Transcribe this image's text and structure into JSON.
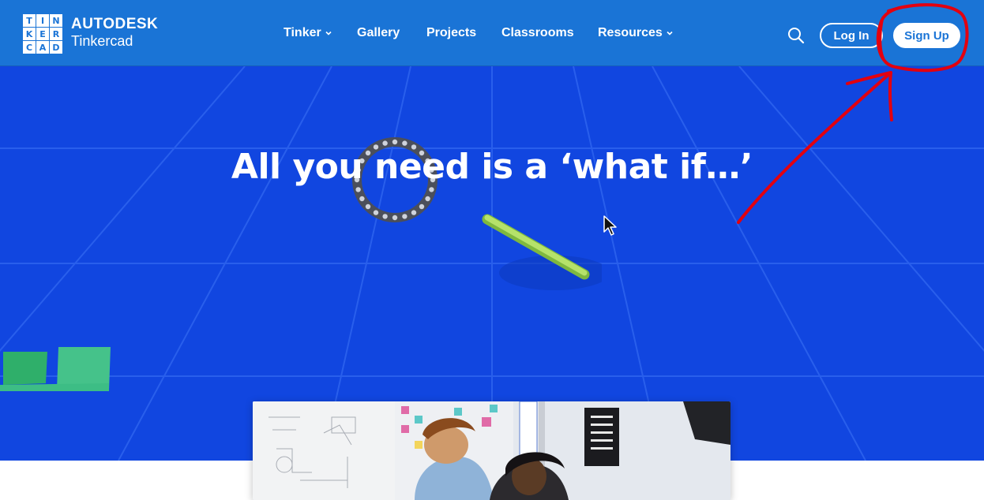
{
  "logo": {
    "grid": [
      "T",
      "I",
      "N",
      "K",
      "E",
      "R",
      "C",
      "A",
      "D"
    ],
    "brand_top": "AUTODESK",
    "brand_bottom": "Tinkercad"
  },
  "nav": {
    "items": [
      {
        "label": "Tinker",
        "has_dropdown": true
      },
      {
        "label": "Gallery",
        "has_dropdown": false
      },
      {
        "label": "Projects",
        "has_dropdown": false
      },
      {
        "label": "Classrooms",
        "has_dropdown": false
      },
      {
        "label": "Resources",
        "has_dropdown": true
      }
    ]
  },
  "header": {
    "search_icon": "search-icon",
    "login_label": "Log In",
    "signup_label": "Sign Up"
  },
  "hero": {
    "headline": "All you need is a ‘what if…’"
  },
  "colors": {
    "header_bg": "#1a74d6",
    "hero_bg": "#1146e0",
    "annotation": "#e3000f",
    "stick": "#a6d957",
    "block": "#3dbd85"
  }
}
